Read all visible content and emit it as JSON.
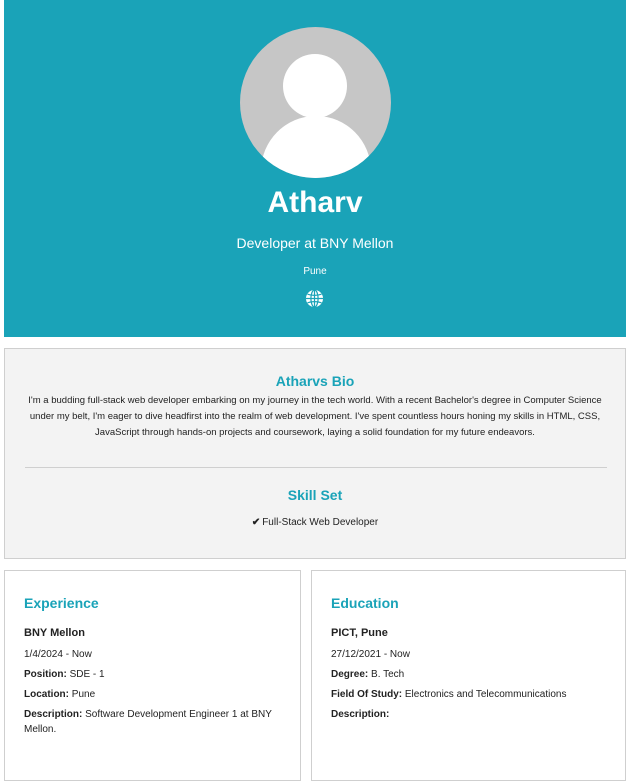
{
  "profile": {
    "name": "Atharv",
    "title": "Developer at BNY Mellon",
    "location": "Pune",
    "website_icon": "globe-icon"
  },
  "bio": {
    "heading": "Atharvs Bio",
    "text": "I'm a budding full-stack web developer embarking on my journey in the tech world. With a recent Bachelor's degree in Computer Science under my belt, I'm eager to dive headfirst into the realm of web development. I've spent countless hours honing my skills in HTML, CSS, JavaScript through hands-on projects and coursework, laying a solid foundation for my future endeavors."
  },
  "skills": {
    "heading": "Skill Set",
    "items": [
      "Full-Stack Web Developer"
    ]
  },
  "experience": {
    "heading": "Experience",
    "company": "BNY Mellon",
    "dates": "1/4/2024 - Now",
    "position_label": "Position:",
    "position": "SDE - 1",
    "location_label": "Location:",
    "location": "Pune",
    "description_label": "Description:",
    "description": "Software Development Engineer 1 at BNY Mellon."
  },
  "education": {
    "heading": "Education",
    "institution": "PICT, Pune",
    "dates": "27/12/2021 - Now",
    "degree_label": "Degree:",
    "degree": "B. Tech",
    "field_label": "Field Of Study:",
    "field": "Electronics and Telecommunications",
    "description_label": "Description:",
    "description": ""
  },
  "colors": {
    "accent": "#1aa3b8",
    "panel_bg": "#f3f3f3",
    "border": "#cfcfcf"
  }
}
